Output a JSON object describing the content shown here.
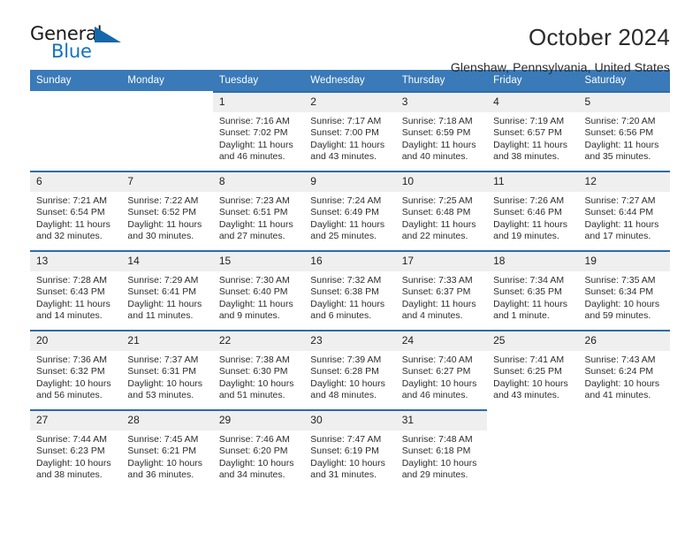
{
  "brand": {
    "line1": "General",
    "line2": "Blue",
    "triangle_color": "#1668ab",
    "blue_color": "#1272c4"
  },
  "header": {
    "month_title": "October 2024",
    "location": "Glenshaw, Pennsylvania, United States",
    "header_bg": "#3a7ab8",
    "header_text": "#ffffff",
    "row_rule_color": "#2e6ca8",
    "daynum_bg": "#efefef"
  },
  "weekdays": [
    "Sunday",
    "Monday",
    "Tuesday",
    "Wednesday",
    "Thursday",
    "Friday",
    "Saturday"
  ],
  "weeks": [
    [
      {
        "day": "",
        "blank": true,
        "sunrise": "",
        "sunset": "",
        "daylight1": "",
        "daylight2": ""
      },
      {
        "day": "",
        "blank": true,
        "sunrise": "",
        "sunset": "",
        "daylight1": "",
        "daylight2": ""
      },
      {
        "day": "1",
        "sunrise": "Sunrise: 7:16 AM",
        "sunset": "Sunset: 7:02 PM",
        "daylight1": "Daylight: 11 hours",
        "daylight2": "and 46 minutes."
      },
      {
        "day": "2",
        "sunrise": "Sunrise: 7:17 AM",
        "sunset": "Sunset: 7:00 PM",
        "daylight1": "Daylight: 11 hours",
        "daylight2": "and 43 minutes."
      },
      {
        "day": "3",
        "sunrise": "Sunrise: 7:18 AM",
        "sunset": "Sunset: 6:59 PM",
        "daylight1": "Daylight: 11 hours",
        "daylight2": "and 40 minutes."
      },
      {
        "day": "4",
        "sunrise": "Sunrise: 7:19 AM",
        "sunset": "Sunset: 6:57 PM",
        "daylight1": "Daylight: 11 hours",
        "daylight2": "and 38 minutes."
      },
      {
        "day": "5",
        "sunrise": "Sunrise: 7:20 AM",
        "sunset": "Sunset: 6:56 PM",
        "daylight1": "Daylight: 11 hours",
        "daylight2": "and 35 minutes."
      }
    ],
    [
      {
        "day": "6",
        "sunrise": "Sunrise: 7:21 AM",
        "sunset": "Sunset: 6:54 PM",
        "daylight1": "Daylight: 11 hours",
        "daylight2": "and 32 minutes."
      },
      {
        "day": "7",
        "sunrise": "Sunrise: 7:22 AM",
        "sunset": "Sunset: 6:52 PM",
        "daylight1": "Daylight: 11 hours",
        "daylight2": "and 30 minutes."
      },
      {
        "day": "8",
        "sunrise": "Sunrise: 7:23 AM",
        "sunset": "Sunset: 6:51 PM",
        "daylight1": "Daylight: 11 hours",
        "daylight2": "and 27 minutes."
      },
      {
        "day": "9",
        "sunrise": "Sunrise: 7:24 AM",
        "sunset": "Sunset: 6:49 PM",
        "daylight1": "Daylight: 11 hours",
        "daylight2": "and 25 minutes."
      },
      {
        "day": "10",
        "sunrise": "Sunrise: 7:25 AM",
        "sunset": "Sunset: 6:48 PM",
        "daylight1": "Daylight: 11 hours",
        "daylight2": "and 22 minutes."
      },
      {
        "day": "11",
        "sunrise": "Sunrise: 7:26 AM",
        "sunset": "Sunset: 6:46 PM",
        "daylight1": "Daylight: 11 hours",
        "daylight2": "and 19 minutes."
      },
      {
        "day": "12",
        "sunrise": "Sunrise: 7:27 AM",
        "sunset": "Sunset: 6:44 PM",
        "daylight1": "Daylight: 11 hours",
        "daylight2": "and 17 minutes."
      }
    ],
    [
      {
        "day": "13",
        "sunrise": "Sunrise: 7:28 AM",
        "sunset": "Sunset: 6:43 PM",
        "daylight1": "Daylight: 11 hours",
        "daylight2": "and 14 minutes."
      },
      {
        "day": "14",
        "sunrise": "Sunrise: 7:29 AM",
        "sunset": "Sunset: 6:41 PM",
        "daylight1": "Daylight: 11 hours",
        "daylight2": "and 11 minutes."
      },
      {
        "day": "15",
        "sunrise": "Sunrise: 7:30 AM",
        "sunset": "Sunset: 6:40 PM",
        "daylight1": "Daylight: 11 hours",
        "daylight2": "and 9 minutes."
      },
      {
        "day": "16",
        "sunrise": "Sunrise: 7:32 AM",
        "sunset": "Sunset: 6:38 PM",
        "daylight1": "Daylight: 11 hours",
        "daylight2": "and 6 minutes."
      },
      {
        "day": "17",
        "sunrise": "Sunrise: 7:33 AM",
        "sunset": "Sunset: 6:37 PM",
        "daylight1": "Daylight: 11 hours",
        "daylight2": "and 4 minutes."
      },
      {
        "day": "18",
        "sunrise": "Sunrise: 7:34 AM",
        "sunset": "Sunset: 6:35 PM",
        "daylight1": "Daylight: 11 hours",
        "daylight2": "and 1 minute."
      },
      {
        "day": "19",
        "sunrise": "Sunrise: 7:35 AM",
        "sunset": "Sunset: 6:34 PM",
        "daylight1": "Daylight: 10 hours",
        "daylight2": "and 59 minutes."
      }
    ],
    [
      {
        "day": "20",
        "sunrise": "Sunrise: 7:36 AM",
        "sunset": "Sunset: 6:32 PM",
        "daylight1": "Daylight: 10 hours",
        "daylight2": "and 56 minutes."
      },
      {
        "day": "21",
        "sunrise": "Sunrise: 7:37 AM",
        "sunset": "Sunset: 6:31 PM",
        "daylight1": "Daylight: 10 hours",
        "daylight2": "and 53 minutes."
      },
      {
        "day": "22",
        "sunrise": "Sunrise: 7:38 AM",
        "sunset": "Sunset: 6:30 PM",
        "daylight1": "Daylight: 10 hours",
        "daylight2": "and 51 minutes."
      },
      {
        "day": "23",
        "sunrise": "Sunrise: 7:39 AM",
        "sunset": "Sunset: 6:28 PM",
        "daylight1": "Daylight: 10 hours",
        "daylight2": "and 48 minutes."
      },
      {
        "day": "24",
        "sunrise": "Sunrise: 7:40 AM",
        "sunset": "Sunset: 6:27 PM",
        "daylight1": "Daylight: 10 hours",
        "daylight2": "and 46 minutes."
      },
      {
        "day": "25",
        "sunrise": "Sunrise: 7:41 AM",
        "sunset": "Sunset: 6:25 PM",
        "daylight1": "Daylight: 10 hours",
        "daylight2": "and 43 minutes."
      },
      {
        "day": "26",
        "sunrise": "Sunrise: 7:43 AM",
        "sunset": "Sunset: 6:24 PM",
        "daylight1": "Daylight: 10 hours",
        "daylight2": "and 41 minutes."
      }
    ],
    [
      {
        "day": "27",
        "sunrise": "Sunrise: 7:44 AM",
        "sunset": "Sunset: 6:23 PM",
        "daylight1": "Daylight: 10 hours",
        "daylight2": "and 38 minutes."
      },
      {
        "day": "28",
        "sunrise": "Sunrise: 7:45 AM",
        "sunset": "Sunset: 6:21 PM",
        "daylight1": "Daylight: 10 hours",
        "daylight2": "and 36 minutes."
      },
      {
        "day": "29",
        "sunrise": "Sunrise: 7:46 AM",
        "sunset": "Sunset: 6:20 PM",
        "daylight1": "Daylight: 10 hours",
        "daylight2": "and 34 minutes."
      },
      {
        "day": "30",
        "sunrise": "Sunrise: 7:47 AM",
        "sunset": "Sunset: 6:19 PM",
        "daylight1": "Daylight: 10 hours",
        "daylight2": "and 31 minutes."
      },
      {
        "day": "31",
        "sunrise": "Sunrise: 7:48 AM",
        "sunset": "Sunset: 6:18 PM",
        "daylight1": "Daylight: 10 hours",
        "daylight2": "and 29 minutes."
      },
      {
        "day": "",
        "blank": true,
        "sunrise": "",
        "sunset": "",
        "daylight1": "",
        "daylight2": ""
      },
      {
        "day": "",
        "blank": true,
        "sunrise": "",
        "sunset": "",
        "daylight1": "",
        "daylight2": ""
      }
    ]
  ]
}
